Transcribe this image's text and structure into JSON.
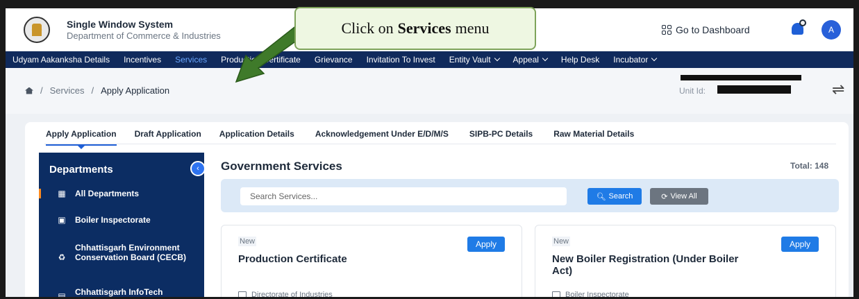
{
  "header": {
    "title": "Single Window System",
    "subtitle": "Department of Commerce & Industries",
    "dashboard_label": "Go to Dashboard",
    "avatar_letter": "A"
  },
  "nav": {
    "items": [
      {
        "label": "Udyam Aakanksha Details"
      },
      {
        "label": "Incentives"
      },
      {
        "label": "Services"
      },
      {
        "label": "Production Certificate"
      },
      {
        "label": "Grievance"
      },
      {
        "label": "Invitation To Invest"
      },
      {
        "label": "Entity Vault"
      },
      {
        "label": "Appeal"
      },
      {
        "label": "Help Desk"
      },
      {
        "label": "Incubator"
      }
    ]
  },
  "breadcrumb": {
    "separator": "/",
    "items": [
      "Services",
      "Apply Application"
    ],
    "unit_id_label": "Unit Id:"
  },
  "tabs": [
    "Apply Application",
    "Draft Application",
    "Application Details",
    "Acknowledgement Under E/D/M/S",
    "SIPB-PC Details",
    "Raw Material Details"
  ],
  "sidebar": {
    "title": "Departments",
    "items": [
      {
        "label": "All Departments",
        "icon": "grid-icon"
      },
      {
        "label": "Boiler Inspectorate",
        "icon": "boiler-icon"
      },
      {
        "label": "Chhattisgarh Environment Conservation Board (CECB)",
        "icon": "recycle-icon"
      },
      {
        "label": "Chhattisgarh InfoTech Promotion Society (CHiPS)",
        "icon": "chip-icon"
      }
    ]
  },
  "main": {
    "title": "Government Services",
    "total": "Total: 148",
    "search_placeholder": "Search Services...",
    "search_label": "Search",
    "view_all_label": "View All"
  },
  "services": [
    {
      "badge": "New",
      "apply": "Apply",
      "title": "Production Certificate",
      "dept": "Directorate of Industries"
    },
    {
      "badge": "New",
      "apply": "Apply",
      "title": "New Boiler Registration (Under Boiler Act)",
      "dept": "Boiler Inspectorate"
    }
  ],
  "callout": {
    "prefix": "Click on",
    "bold": "Services",
    "suffix": "menu"
  },
  "colors": {
    "nav_bg": "#102a5c",
    "sidebar_bg": "#0c2d63",
    "accent_blue": "#1f7be6",
    "active_nav": "#6aa7ff",
    "callout_border": "#7ea35a"
  }
}
